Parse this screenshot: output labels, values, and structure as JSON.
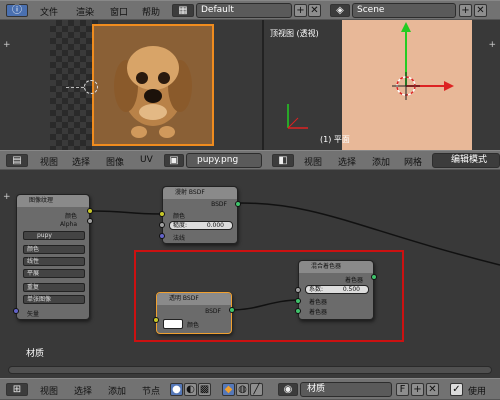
{
  "top_header": {
    "menus": [
      "文件",
      "渲染",
      "窗口",
      "帮助"
    ],
    "layout_value": "Default",
    "scene_value": "Scene"
  },
  "uv_editor": {
    "menus": [
      "视图",
      "选择",
      "图像",
      "UV"
    ],
    "image_name": "pupy.png"
  },
  "viewport_3d": {
    "view_label": "顶视图 (透视)",
    "object_label": "(1) 平面",
    "menus": [
      "视图",
      "选择",
      "添加",
      "网格"
    ],
    "mode": "编辑模式"
  },
  "node_editor": {
    "tree_label": "材质",
    "image_texture": {
      "title": "图像纹理",
      "out_color": "颜色",
      "out_alpha": "Alpha",
      "image": "pupy",
      "color_space": "颜色",
      "interpolation": "线性",
      "projection": "平展",
      "extension": "重复",
      "source": "单张图像",
      "in_vector": "矢量"
    },
    "diffuse": {
      "title": "漫射 BSDF",
      "out": "BSDF",
      "in_color": "颜色",
      "roughness_label": "糙度:",
      "roughness_value": "0.000",
      "in_normal": "法线"
    },
    "transparent": {
      "title": "透明 BSDF",
      "out": "BSDF",
      "in_color": "颜色"
    },
    "mix": {
      "title": "混合着色器",
      "out": "着色器",
      "fac_label": "系数:",
      "fac_value": "0.500",
      "in_shader1": "着色器",
      "in_shader2": "着色器"
    }
  },
  "bottom_header": {
    "menus": [
      "视图",
      "选择",
      "添加",
      "节点"
    ],
    "material_name": "材质",
    "fake_user": "F",
    "use_nodes": "使用"
  },
  "colors": {
    "highlight_box": "#cc1111",
    "selected_node": "#f0a030",
    "socket_color": "#c7c729",
    "socket_shader": "#3fc26b",
    "socket_vector": "#6363c7"
  }
}
